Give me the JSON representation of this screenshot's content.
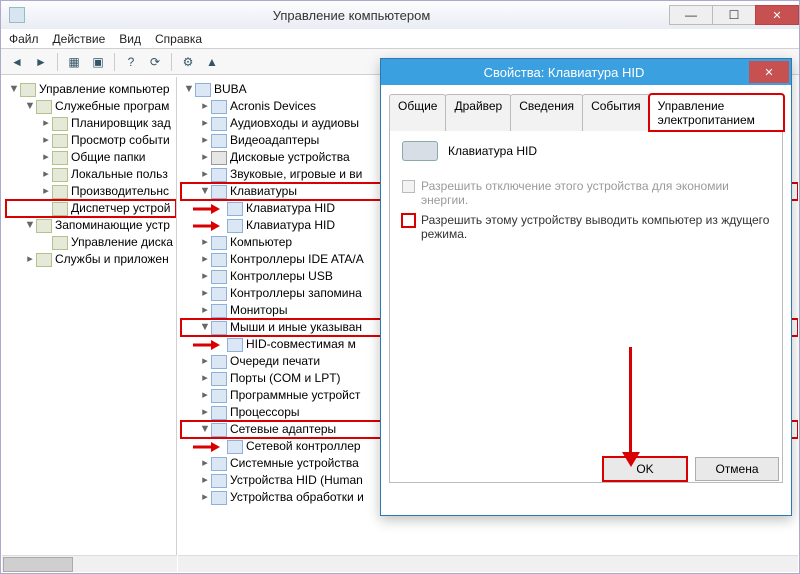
{
  "window": {
    "title": "Управление компьютером",
    "menu": {
      "file": "Файл",
      "action": "Действие",
      "view": "Вид",
      "help": "Справка"
    }
  },
  "left_tree": [
    {
      "level": 1,
      "twist": "▼",
      "label": "Управление компьютер",
      "icon": "root"
    },
    {
      "level": 2,
      "twist": "▼",
      "label": "Служебные програм",
      "icon": "folder"
    },
    {
      "level": 3,
      "twist": "▸",
      "label": "Планировщик зад",
      "icon": "svc"
    },
    {
      "level": 3,
      "twist": "▸",
      "label": "Просмотр событи",
      "icon": "svc"
    },
    {
      "level": 3,
      "twist": "▸",
      "label": "Общие папки",
      "icon": "svc"
    },
    {
      "level": 3,
      "twist": "▸",
      "label": "Локальные польз",
      "icon": "svc"
    },
    {
      "level": 3,
      "twist": "▸",
      "label": "Производительнс",
      "icon": "svc"
    },
    {
      "level": 3,
      "twist": "",
      "label": "Диспетчер устрой",
      "icon": "svc",
      "red": true
    },
    {
      "level": 2,
      "twist": "▼",
      "label": "Запоминающие устр",
      "icon": "folder"
    },
    {
      "level": 3,
      "twist": "",
      "label": "Управление диска",
      "icon": "svc"
    },
    {
      "level": 2,
      "twist": "▸",
      "label": "Службы и приложен",
      "icon": "folder"
    }
  ],
  "mid_tree": [
    {
      "level": 1,
      "twist": "▼",
      "label": "BUBA",
      "icon": "pc"
    },
    {
      "level": 2,
      "twist": "▸",
      "label": "Acronis Devices",
      "icon": "dev"
    },
    {
      "level": 2,
      "twist": "▸",
      "label": "Аудиовходы и аудиовы",
      "icon": "dev"
    },
    {
      "level": 2,
      "twist": "▸",
      "label": "Видеоадаптеры",
      "icon": "dev"
    },
    {
      "level": 2,
      "twist": "▸",
      "label": "Дисковые устройства",
      "icon": "disk"
    },
    {
      "level": 2,
      "twist": "▸",
      "label": "Звуковые, игровые и ви",
      "icon": "dev"
    },
    {
      "level": 2,
      "twist": "▼",
      "label": "Клавиатуры",
      "icon": "dev",
      "red": true
    },
    {
      "level": 3,
      "twist": "",
      "label": "Клавиатура HID",
      "icon": "dev",
      "arrow": true
    },
    {
      "level": 3,
      "twist": "",
      "label": "Клавиатура HID",
      "icon": "dev",
      "arrow": true
    },
    {
      "level": 2,
      "twist": "▸",
      "label": "Компьютер",
      "icon": "pc"
    },
    {
      "level": 2,
      "twist": "▸",
      "label": "Контроллеры IDE ATA/A",
      "icon": "dev"
    },
    {
      "level": 2,
      "twist": "▸",
      "label": "Контроллеры USB",
      "icon": "dev"
    },
    {
      "level": 2,
      "twist": "▸",
      "label": "Контроллеры запомина",
      "icon": "dev"
    },
    {
      "level": 2,
      "twist": "▸",
      "label": "Мониторы",
      "icon": "dev"
    },
    {
      "level": 2,
      "twist": "▼",
      "label": "Мыши и иные указыван",
      "icon": "dev",
      "red": true
    },
    {
      "level": 3,
      "twist": "",
      "label": "HID-совместимая м",
      "icon": "dev",
      "arrow": true
    },
    {
      "level": 2,
      "twist": "▸",
      "label": "Очереди печати",
      "icon": "dev"
    },
    {
      "level": 2,
      "twist": "▸",
      "label": "Порты (COM и LPT)",
      "icon": "dev"
    },
    {
      "level": 2,
      "twist": "▸",
      "label": "Программные устройст",
      "icon": "dev"
    },
    {
      "level": 2,
      "twist": "▸",
      "label": "Процессоры",
      "icon": "dev"
    },
    {
      "level": 2,
      "twist": "▼",
      "label": "Сетевые адаптеры",
      "icon": "dev",
      "red": true
    },
    {
      "level": 3,
      "twist": "",
      "label": "Сетевой контроллер",
      "icon": "dev",
      "arrow": true
    },
    {
      "level": 2,
      "twist": "▸",
      "label": "Системные устройства",
      "icon": "dev"
    },
    {
      "level": 2,
      "twist": "▸",
      "label": "Устройства HID (Human",
      "icon": "dev"
    },
    {
      "level": 2,
      "twist": "▸",
      "label": "Устройства обработки и",
      "icon": "dev"
    }
  ],
  "dialog": {
    "title": "Свойства: Клавиатура HID",
    "tabs": {
      "general": "Общие",
      "driver": "Драйвер",
      "details": "Сведения",
      "events": "События",
      "power": "Управление электропитанием"
    },
    "active_tab": "power",
    "device_name": "Клавиатура HID",
    "opt_allow_off": "Разрешить отключение этого устройства для экономии энергии.",
    "opt_wake": "Разрешить этому устройству выводить компьютер из ждущего режима.",
    "btn_ok": "OK",
    "btn_cancel": "Отмена"
  }
}
